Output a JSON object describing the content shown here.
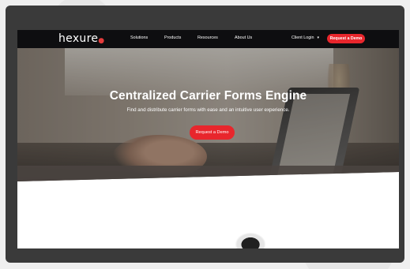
{
  "nav": {
    "logo_text": "hexure",
    "logo_dot": "●",
    "items": [
      "Solutions",
      "Products",
      "Resources",
      "About Us"
    ],
    "client_login": "Client Login",
    "client_login_chevron": "▾",
    "cta": "Request a Demo"
  },
  "hero": {
    "title": "Centralized Carrier Forms Engine",
    "subtitle": "Find and distribute carrier forms with ease and an intuitive user experience.",
    "cta": "Request a Demo"
  },
  "colors": {
    "accent": "#e8262c",
    "nav_bg": "#0e0e10",
    "frame": "#3a3a3a"
  }
}
